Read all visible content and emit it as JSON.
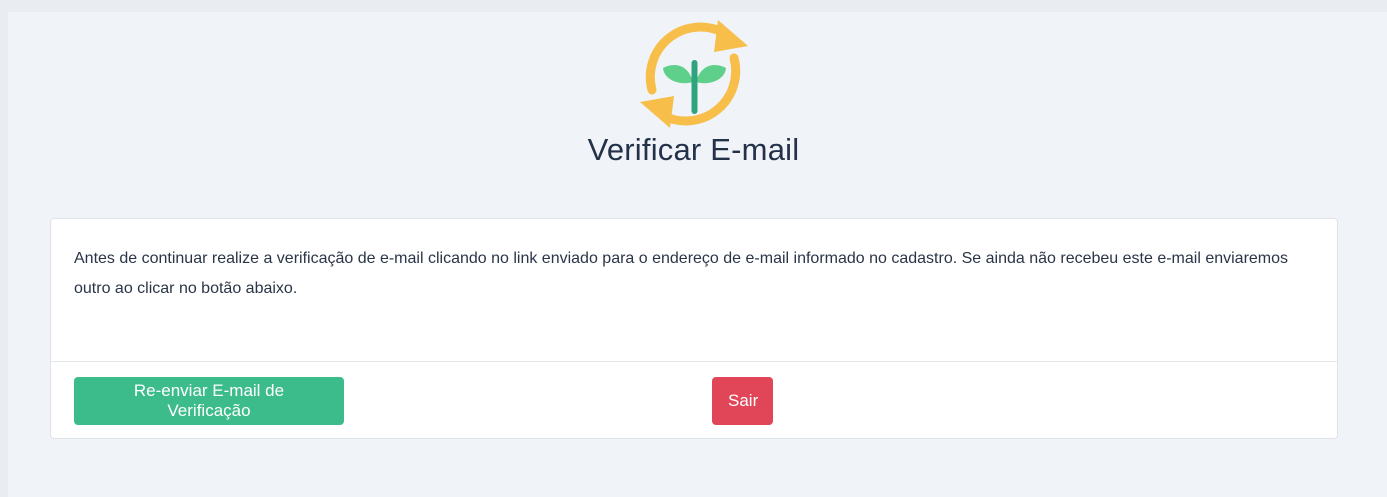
{
  "logo": {
    "icon": "plant-refresh-icon",
    "colors": {
      "arrow": "#f7bf4a",
      "leaf": "#5fcf8c",
      "stem": "#2fa37e"
    }
  },
  "header": {
    "title": "Verificar E-mail"
  },
  "card": {
    "message": "Antes de continuar realize a verificação de e-mail clicando no link enviado para o endereço de e-mail informado no cadastro. Se ainda não recebeu este e-mail enviaremos outro ao clicar no botão abaixo.",
    "resend_label": "Re-enviar E-mail de Verificação",
    "logout_label": "Sair"
  },
  "colors": {
    "background": "#f0f3f8",
    "primary": "#3cbb8b",
    "danger": "#e04657",
    "text": "#243249"
  }
}
